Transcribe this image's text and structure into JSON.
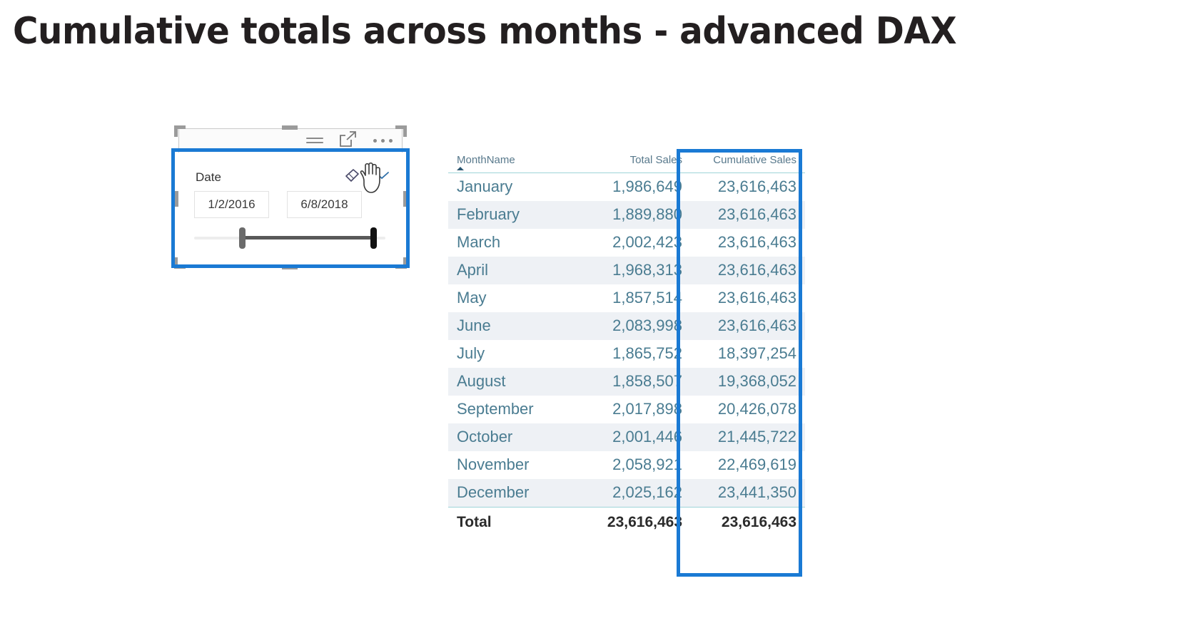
{
  "page": {
    "title": "Cumulative totals across months - advanced DAX",
    "accent_blue": "#1a7ad4",
    "header_teal": "#9ed4d8",
    "table_text_color": "#4a7c91"
  },
  "slicer": {
    "field_label": "Date",
    "start_date": "1/2/2016",
    "end_date": "6/8/2018",
    "icons": {
      "filter": "filter-icon",
      "focus_mode": "focus-mode-icon",
      "more_options": "more-options-icon",
      "clear_selection": "eraser-icon",
      "expand": "chevron-down-icon"
    }
  },
  "table": {
    "columns": [
      {
        "label": "MonthName",
        "align": "left",
        "sorted": true
      },
      {
        "label": "Total Sales",
        "align": "right",
        "sorted": false
      },
      {
        "label": "Cumulative Sales",
        "align": "right",
        "sorted": false
      }
    ],
    "rows": [
      {
        "month": "January",
        "total_sales": "1,986,649",
        "cumulative_sales": "23,616,463"
      },
      {
        "month": "February",
        "total_sales": "1,889,880",
        "cumulative_sales": "23,616,463"
      },
      {
        "month": "March",
        "total_sales": "2,002,423",
        "cumulative_sales": "23,616,463"
      },
      {
        "month": "April",
        "total_sales": "1,968,313",
        "cumulative_sales": "23,616,463"
      },
      {
        "month": "May",
        "total_sales": "1,857,514",
        "cumulative_sales": "23,616,463"
      },
      {
        "month": "June",
        "total_sales": "2,083,998",
        "cumulative_sales": "23,616,463"
      },
      {
        "month": "July",
        "total_sales": "1,865,752",
        "cumulative_sales": "18,397,254"
      },
      {
        "month": "August",
        "total_sales": "1,858,507",
        "cumulative_sales": "19,368,052"
      },
      {
        "month": "September",
        "total_sales": "2,017,898",
        "cumulative_sales": "20,426,078"
      },
      {
        "month": "October",
        "total_sales": "2,001,446",
        "cumulative_sales": "21,445,722"
      },
      {
        "month": "November",
        "total_sales": "2,058,921",
        "cumulative_sales": "22,469,619"
      },
      {
        "month": "December",
        "total_sales": "2,025,162",
        "cumulative_sales": "23,441,350"
      }
    ],
    "total_row": {
      "label": "Total",
      "total_sales": "23,616,463",
      "cumulative_sales": "23,616,463"
    }
  },
  "chart_data": {
    "type": "table",
    "title": "Cumulative totals across months - advanced DAX",
    "categories": [
      "January",
      "February",
      "March",
      "April",
      "May",
      "June",
      "July",
      "August",
      "September",
      "October",
      "November",
      "December"
    ],
    "series": [
      {
        "name": "Total Sales",
        "values": [
          1986649,
          1889880,
          2002423,
          1968313,
          1857514,
          2083998,
          1865752,
          1858507,
          2017898,
          2001446,
          2058921,
          2025162
        ],
        "total": 23616463
      },
      {
        "name": "Cumulative Sales",
        "values": [
          23616463,
          23616463,
          23616463,
          23616463,
          23616463,
          23616463,
          18397254,
          19368052,
          20426078,
          21445722,
          22469619,
          23441350
        ],
        "total": 23616463
      }
    ],
    "xlabel": "MonthName",
    "ylabel": "",
    "grid": false,
    "legend": "none"
  }
}
